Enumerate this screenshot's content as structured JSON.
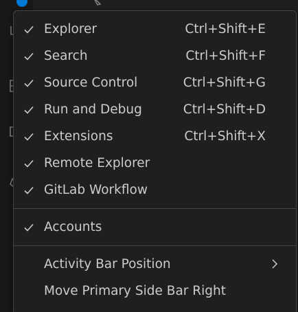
{
  "menu": {
    "view_items": [
      {
        "label": "Explorer",
        "shortcut": "Ctrl+Shift+E",
        "checked": true
      },
      {
        "label": "Search",
        "shortcut": "Ctrl+Shift+F",
        "checked": true
      },
      {
        "label": "Source Control",
        "shortcut": "Ctrl+Shift+G",
        "checked": true
      },
      {
        "label": "Run and Debug",
        "shortcut": "Ctrl+Shift+D",
        "checked": true
      },
      {
        "label": "Extensions",
        "shortcut": "Ctrl+Shift+X",
        "checked": true
      },
      {
        "label": "Remote Explorer",
        "checked": true
      },
      {
        "label": "GitLab Workflow",
        "checked": true
      }
    ],
    "accounts": {
      "label": "Accounts",
      "checked": true
    },
    "activity_bar_position": {
      "label": "Activity Bar Position",
      "icon": "chevron-right-icon"
    },
    "move_primary_side_bar": {
      "label": "Move Primary Side Bar Right"
    }
  },
  "colors": {
    "menu_background": "#1f1f1f",
    "menu_border": "#454545",
    "text": "#cccccc",
    "badge": "#0078d4"
  },
  "icons": {
    "check": "check-icon",
    "submenu": "chevron-right-icon"
  }
}
